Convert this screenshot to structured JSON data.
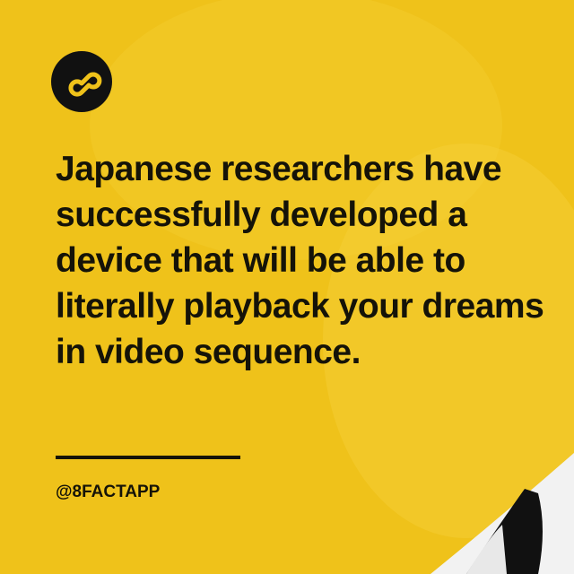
{
  "brand": {
    "logo_icon": "infinity-eight-icon",
    "accent_color": "#efc21a"
  },
  "headline": "Japanese researchers have successfully developed a device that will be able to literally playback your dreams in video sequence.",
  "handle": "@8FACTAPP"
}
